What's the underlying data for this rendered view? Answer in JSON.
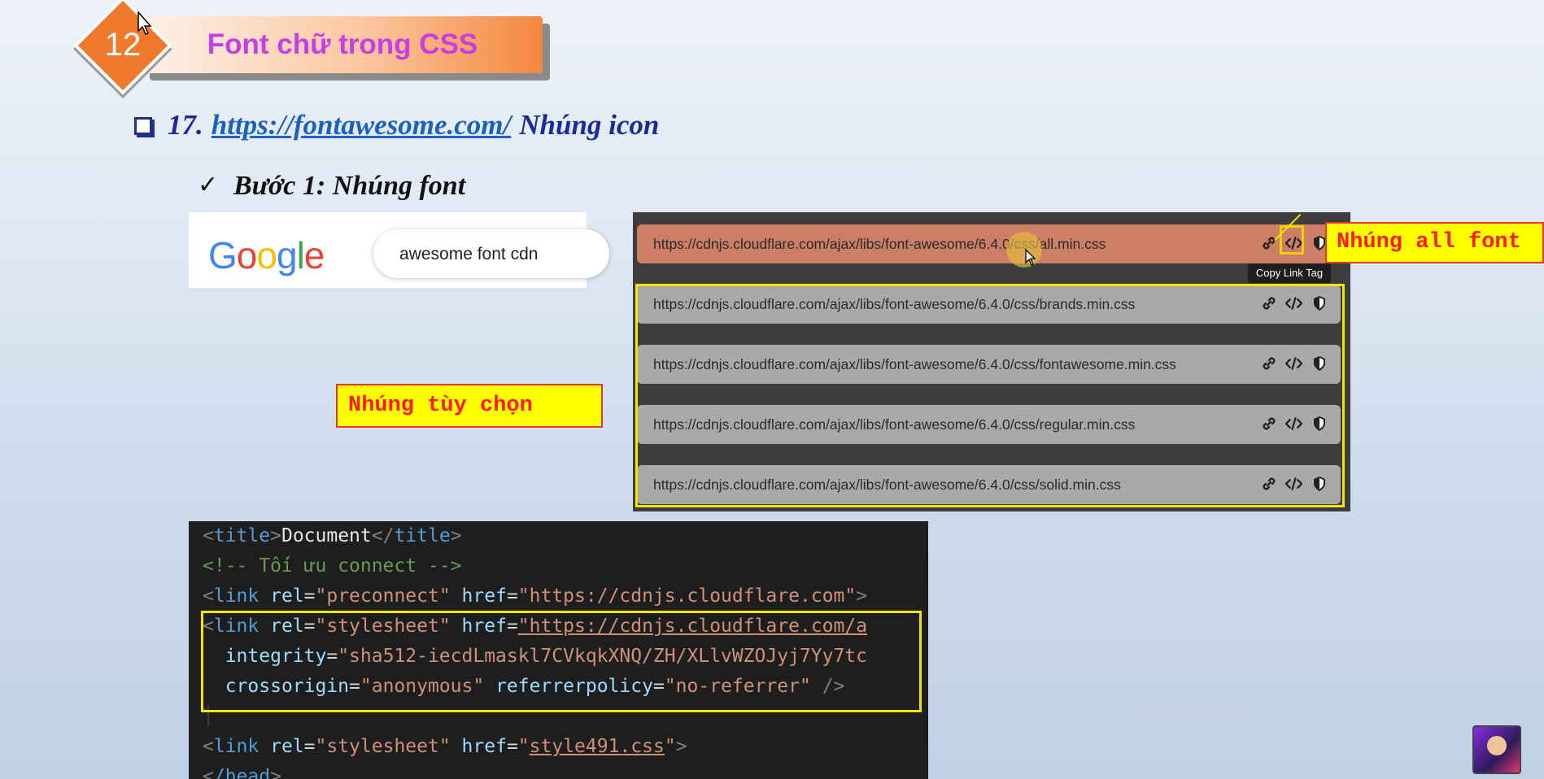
{
  "header": {
    "number": "12",
    "title": "Font chữ trong CSS"
  },
  "section": {
    "prefix": "17.",
    "link": "https://fontawesome.com/",
    "suffix": "Nhúng icon"
  },
  "step": {
    "check": "✓",
    "label": "Bước 1: Nhúng font"
  },
  "google": {
    "logo": "Google",
    "query": "awesome font cdn"
  },
  "cdn": {
    "rows": [
      {
        "url": "https://cdnjs.cloudflare.com/ajax/libs/font-awesome/6.4.0/css/all.min.css"
      },
      {
        "url": "https://cdnjs.cloudflare.com/ajax/libs/font-awesome/6.4.0/css/brands.min.css"
      },
      {
        "url": "https://cdnjs.cloudflare.com/ajax/libs/font-awesome/6.4.0/css/fontawesome.min.css"
      },
      {
        "url": "https://cdnjs.cloudflare.com/ajax/libs/font-awesome/6.4.0/css/regular.min.css"
      },
      {
        "url": "https://cdnjs.cloudflare.com/ajax/libs/font-awesome/6.4.0/css/solid.min.css"
      }
    ],
    "tooltip": "Copy Link Tag"
  },
  "callouts": {
    "all": "Nhúng all font",
    "optional": "Nhúng tùy chọn"
  },
  "code": {
    "l1": {
      "open": "title",
      "text": "Document",
      "close": "title"
    },
    "l2": {
      "comment": "<!-- Tối ưu connect -->"
    },
    "l3": {
      "tag": "link",
      "a1": "rel",
      "v1": "\"preconnect\"",
      "a2": "href",
      "v2": "\"https://cdnjs.cloudflare.com\""
    },
    "l4": {
      "tag": "link",
      "a1": "rel",
      "v1": "\"stylesheet\"",
      "a2": "href",
      "v2": "\"https://cdnjs.cloudflare.com/a"
    },
    "l5": {
      "a1": "integrity",
      "v1": "\"sha512-iecdLmaskl7CVkqkXNQ/ZH/XLlvWZOJyj7Yy7tc"
    },
    "l6": {
      "a1": "crossorigin",
      "v1": "\"anonymous\"",
      "a2": "referrerpolicy",
      "v2": "\"no-referrer\"",
      "end": "/>"
    },
    "l8": {
      "tag": "link",
      "a1": "rel",
      "v1": "\"stylesheet\"",
      "a2": "href",
      "v2": "style491.css"
    },
    "l9": {
      "close": "/head"
    }
  },
  "colors": {
    "accent_orange": "#ef7a2c",
    "title_magenta": "#c53ee6",
    "heading_blue": "#1a2a9a",
    "highlight_yellow": "#f2e600",
    "callout_red": "#ff1a1a"
  }
}
